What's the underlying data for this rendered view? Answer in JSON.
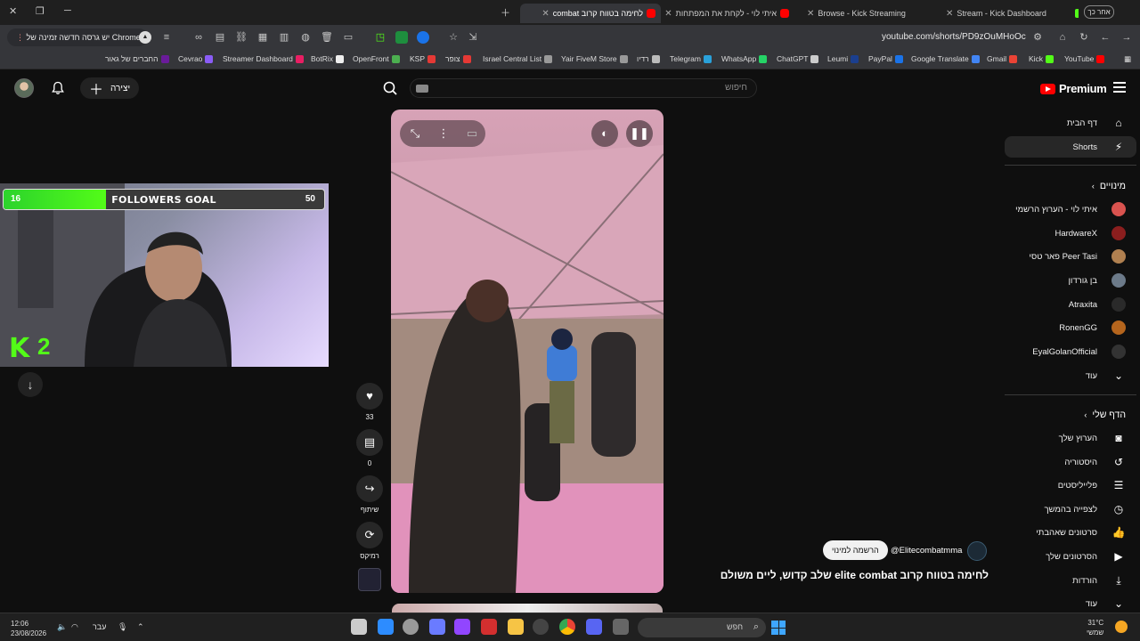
{
  "browser": {
    "tabs": [
      {
        "label": "אחר כך",
        "kind": "chip"
      },
      {
        "label": "Stream - Kick Dashboard",
        "kind": "kick"
      },
      {
        "label": "Browse - Kick Streaming",
        "kind": "kick"
      },
      {
        "label": "איתי לוי - לקחת את המפתחות",
        "kind": "yt"
      },
      {
        "label": "לחימה בטווח קרוב combat",
        "kind": "yt",
        "active": true
      }
    ],
    "update_chip": "יש גרסה חדשה זמינה של Chrome",
    "url": "youtube.com/shorts/PD9zOuMHoOc",
    "bookmarks": [
      {
        "label": "YouTube",
        "color": "#ff0000"
      },
      {
        "label": "Kick",
        "color": "#53fc18"
      },
      {
        "label": "Gmail",
        "color": "#ea4335"
      },
      {
        "label": "Google Translate",
        "color": "#4285f4"
      },
      {
        "label": "PayPal",
        "color": "#1a73e8"
      },
      {
        "label": "Leumi",
        "color": "#1b3f8f"
      },
      {
        "label": "ChatGPT",
        "color": "#cccccc"
      },
      {
        "label": "WhatsApp",
        "color": "#25d366"
      },
      {
        "label": "Telegram",
        "color": "#2aa1da"
      },
      {
        "label": "רדיו",
        "color": "#bbbbbb"
      },
      {
        "label": "Yair FiveM Store",
        "color": "#999999"
      },
      {
        "label": "Israel Central List",
        "color": "#999999"
      },
      {
        "label": "צופר",
        "color": "#e53935"
      },
      {
        "label": "KSP",
        "color": "#e53935"
      },
      {
        "label": "OpenFront",
        "color": "#4caf50"
      },
      {
        "label": "BotRix",
        "color": "#eeeeee"
      },
      {
        "label": "Streamer Dashboard",
        "color": "#e91e63"
      },
      {
        "label": "Cevrao",
        "color": "#8a5cf6"
      },
      {
        "label": "החברים של גאור",
        "color": "#6a1b9a"
      }
    ]
  },
  "youtube": {
    "logo_text": "Premium",
    "search_placeholder": "חיפוש",
    "create_label": "יצירה",
    "sidebar": {
      "main": [
        {
          "label": "דף הבית",
          "icon": "home-icon"
        },
        {
          "label": "Shorts",
          "icon": "shorts-icon",
          "active": true
        }
      ],
      "subs_header": "מינויים",
      "subs": [
        {
          "label": "איתי לוי - הערוץ הרשמי",
          "color": "#d9534f"
        },
        {
          "label": "HardwareX",
          "color": "#8b1e1e"
        },
        {
          "label": "Peer Tasi פאר טסי",
          "color": "#b08050"
        },
        {
          "label": "בן גורדון",
          "color": "#6c7a89"
        },
        {
          "label": "Atraxita",
          "color": "#2a2a2a"
        },
        {
          "label": "RonenGG",
          "color": "#b5651d"
        },
        {
          "label": "EyalGolanOfficial",
          "color": "#333333"
        }
      ],
      "subs_more": "עוד",
      "you_header": "הדף שלי",
      "you": [
        {
          "label": "הערוץ שלך",
          "icon": "channel-icon"
        },
        {
          "label": "היסטוריה",
          "icon": "history-icon"
        },
        {
          "label": "פלייליסטים",
          "icon": "playlist-icon"
        },
        {
          "label": "לצפייה בהמשך",
          "icon": "clock-icon"
        },
        {
          "label": "סרטונים שאהבתי",
          "icon": "thumbs-up-icon"
        },
        {
          "label": "הסרטונים שלך",
          "icon": "video-icon"
        },
        {
          "label": "הורדות",
          "icon": "download-icon"
        }
      ],
      "you_more": "עוד"
    },
    "short": {
      "likes": "33",
      "comments": "0",
      "share_label": "שיתוף",
      "remix_label": "רמיקס",
      "handle": "@Elitecombatmma",
      "subscribe_label": "הרשמה למינוי",
      "title": "לחימה בטווח קרוב elite combat שלב קדוש, ליים משולם"
    }
  },
  "stream_overlay": {
    "goal_label": "FOLLOWERS GOAL",
    "goal_current": "16",
    "goal_target": "50",
    "goal_progress": 0.32,
    "kick_letter": "K",
    "kick_count": "2"
  },
  "taskbar": {
    "time": "12:06",
    "date": "23/08/2026",
    "lang": "עבר",
    "search_label": "חפש",
    "temp": "31°C",
    "weather": "שמשי"
  }
}
